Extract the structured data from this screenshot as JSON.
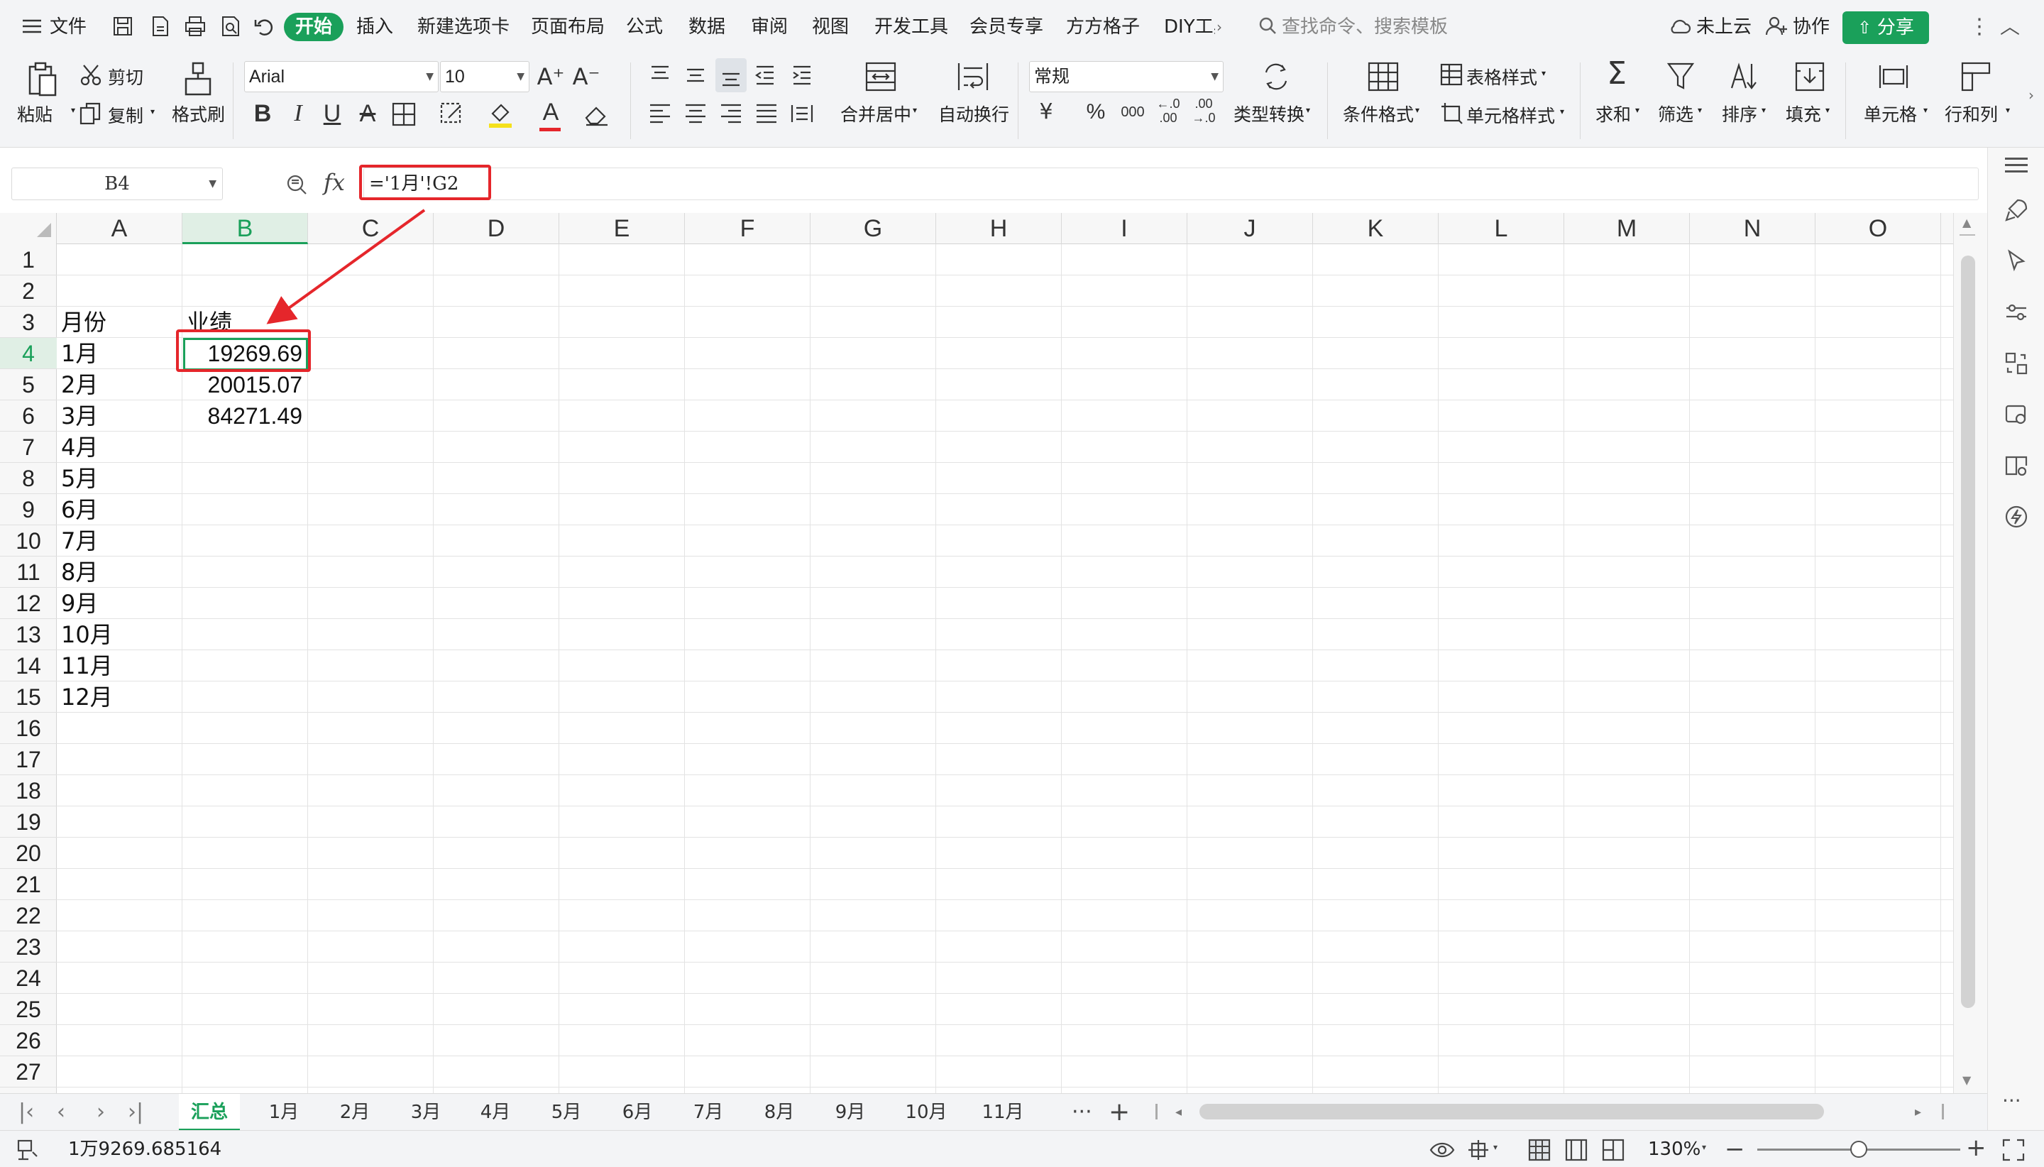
{
  "menubar": {
    "file": "文件",
    "tabs": [
      "开始",
      "插入",
      "新建选项卡",
      "页面布局",
      "公式",
      "数据",
      "审阅",
      "视图",
      "开发工具",
      "会员专享",
      "方方格子",
      "DIY工具"
    ],
    "active_tab": "开始",
    "search_placeholder": "查找命令、搜索模板",
    "cloud": "未上云",
    "collab": "协作",
    "share": "分享"
  },
  "ribbon": {
    "paste": "粘贴",
    "cut": "剪切",
    "copy": "复制",
    "format_painter": "格式刷",
    "font_name": "Arial",
    "font_size": "10",
    "bold": "B",
    "italic": "I",
    "underline": "U",
    "merge_center": "合并居中",
    "wrap_text": "自动换行",
    "number_format": "常规",
    "currency": "¥",
    "percent": "%",
    "thousands": "000",
    "type_convert": "类型转换",
    "conditional_format": "条件格式",
    "table_style": "表格样式",
    "cell_style": "单元格样式",
    "sum": "求和",
    "filter": "筛选",
    "sort": "排序",
    "fill": "填充",
    "cells": "单元格",
    "row_col": "行和列"
  },
  "formula_bar": {
    "cell_ref": "B4",
    "fx": "fx",
    "formula": "='1月'!G2"
  },
  "grid": {
    "columns": [
      "A",
      "B",
      "C",
      "D",
      "E",
      "F",
      "G",
      "H",
      "I",
      "J",
      "K",
      "L",
      "M",
      "N",
      "O"
    ],
    "active_column": "B",
    "active_row": "4",
    "rows": [
      "1",
      "2",
      "3",
      "4",
      "5",
      "6",
      "7",
      "8",
      "9",
      "10",
      "11",
      "12",
      "13",
      "14",
      "15",
      "16",
      "17",
      "18",
      "19",
      "20",
      "21",
      "22",
      "23",
      "24",
      "25",
      "26",
      "27"
    ],
    "header_month": "月份",
    "header_value": "业绩",
    "months": [
      "1月",
      "2月",
      "3月",
      "4月",
      "5月",
      "6月",
      "7月",
      "8月",
      "9月",
      "10月",
      "11月",
      "12月"
    ],
    "values": [
      "19269.69",
      "20015.07",
      "84271.49"
    ]
  },
  "sheets": {
    "tabs": [
      "汇总",
      "1月",
      "2月",
      "3月",
      "4月",
      "5月",
      "6月",
      "7月",
      "8月",
      "9月",
      "10月",
      "11月"
    ],
    "active": "汇总",
    "more": "···",
    "add": "+"
  },
  "status": {
    "value": "1万9269.685164",
    "zoom": "130%",
    "zoom_fraction": 0.5
  },
  "colors": {
    "accent": "#1aa05a",
    "highlight": "#e5262b"
  }
}
